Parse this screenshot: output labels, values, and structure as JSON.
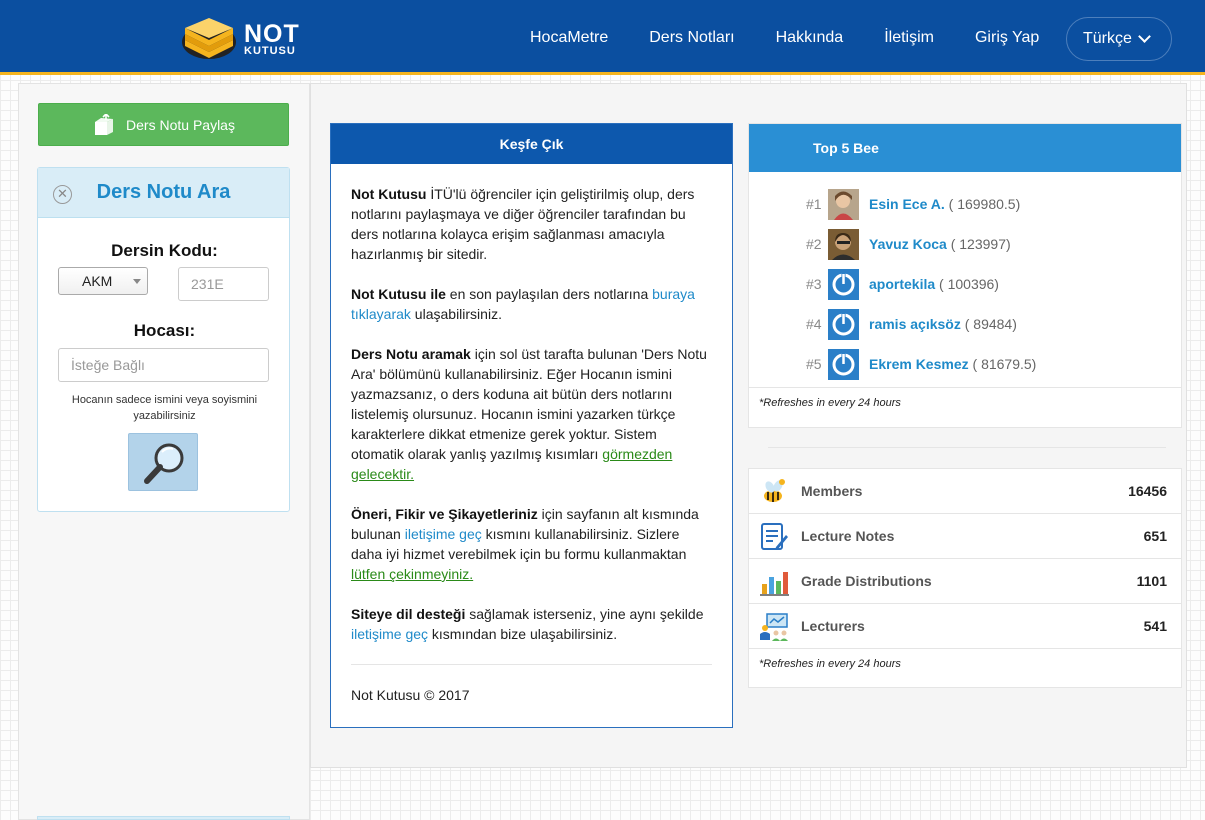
{
  "header": {
    "logo_line1": "NOT",
    "logo_line2": "KUTUSU",
    "nav": [
      "HocaMetre",
      "Ders Notları",
      "Hakkında",
      "İletişim",
      "Giriş Yap"
    ],
    "language": "Türkçe",
    "colors": {
      "bar": "#0b4fa0",
      "accent": "#f5b41e"
    }
  },
  "sidebar": {
    "share_button": "Ders Notu Paylaş",
    "search_panel": {
      "title": "Ders Notu Ara",
      "course_code_label": "Dersin Kodu:",
      "department_select": "AKM",
      "course_code_placeholder": "231E",
      "lecturer_label": "Hocası:",
      "lecturer_placeholder": "İsteğe Bağlı",
      "hint": "Hocanın sadece ismini veya soyismini yazabilirsiniz",
      "search_icon": "magnifier-icon"
    }
  },
  "explore": {
    "title": "Keşfe Çık",
    "p1_bold": "Not Kutusu",
    "p1_text": " İTÜ'lü öğrenciler için geliştirilmiş olup, ders notlarını paylaşmaya ve diğer öğrenciler tarafından bu ders notlarına kolayca erişim sağlanması amacıyla hazırlanmış bir sitedir.",
    "p2_bold": "Not Kutusu ile",
    "p2_text": " en son paylaşılan ders notlarına ",
    "p2_link": "buraya tıklayarak",
    "p2_text2": " ulaşabilirsiniz.",
    "p3_bold": "Ders Notu aramak",
    "p3_text": " için sol üst tarafta bulunan 'Ders Notu Ara' bölümünü kullanabilirsiniz. Eğer Hocanın ismini yazmazsanız, o ders koduna ait bütün ders notlarını listelemiş olursunuz. Hocanın ismini yazarken türkçe karakterlere dikkat etmenize gerek yoktur. Sistem otomatik olarak yanlış yazılmış kısımları ",
    "p3_link": "görmezden gelecektir.",
    "p4_bold": "Öneri, Fikir ve Şikayetleriniz",
    "p4_text": " için sayfanın alt kısmında bulunan ",
    "p4_link": "iletişime geç",
    "p4_text2": " kısmını kullanabilirsiniz. Sizlere daha iyi hizmet verebilmek için bu formu kullanmaktan ",
    "p4_link2": "lütfen çekinmeyiniz.",
    "p5_bold": "Siteye dil desteği",
    "p5_text": " sağlamak isterseniz, yine aynı şekilde ",
    "p5_link": "iletişime geç",
    "p5_text2": " kısmından bize ulaşabilirsiniz.",
    "footer": "Not Kutusu © 2017"
  },
  "top5": {
    "title": "Top 5 Bee",
    "users": [
      {
        "rank": "#1",
        "name": "Esin Ece A.",
        "score": "( 169980.5)",
        "avatar": "photo-avatar"
      },
      {
        "rank": "#2",
        "name": "Yavuz Koca",
        "score": "( 123997)",
        "avatar": "photo-avatar"
      },
      {
        "rank": "#3",
        "name": "aportekila",
        "score": "( 100396)",
        "avatar": "power-avatar-icon"
      },
      {
        "rank": "#4",
        "name": "ramis açıksöz",
        "score": "( 89484)",
        "avatar": "power-avatar-icon"
      },
      {
        "rank": "#5",
        "name": "Ekrem Kesmez",
        "score": "( 81679.5)",
        "avatar": "power-avatar-icon"
      }
    ],
    "note": "*Refreshes in every 24 hours"
  },
  "stats": {
    "rows": [
      {
        "label": "Members",
        "value": "16456",
        "icon": "bees-icon"
      },
      {
        "label": "Lecture Notes",
        "value": "651",
        "icon": "notes-icon"
      },
      {
        "label": "Grade Distributions",
        "value": "1101",
        "icon": "bar-chart-icon"
      },
      {
        "label": "Lecturers",
        "value": "541",
        "icon": "lecturer-icon"
      }
    ],
    "note": "*Refreshes in every 24 hours"
  }
}
